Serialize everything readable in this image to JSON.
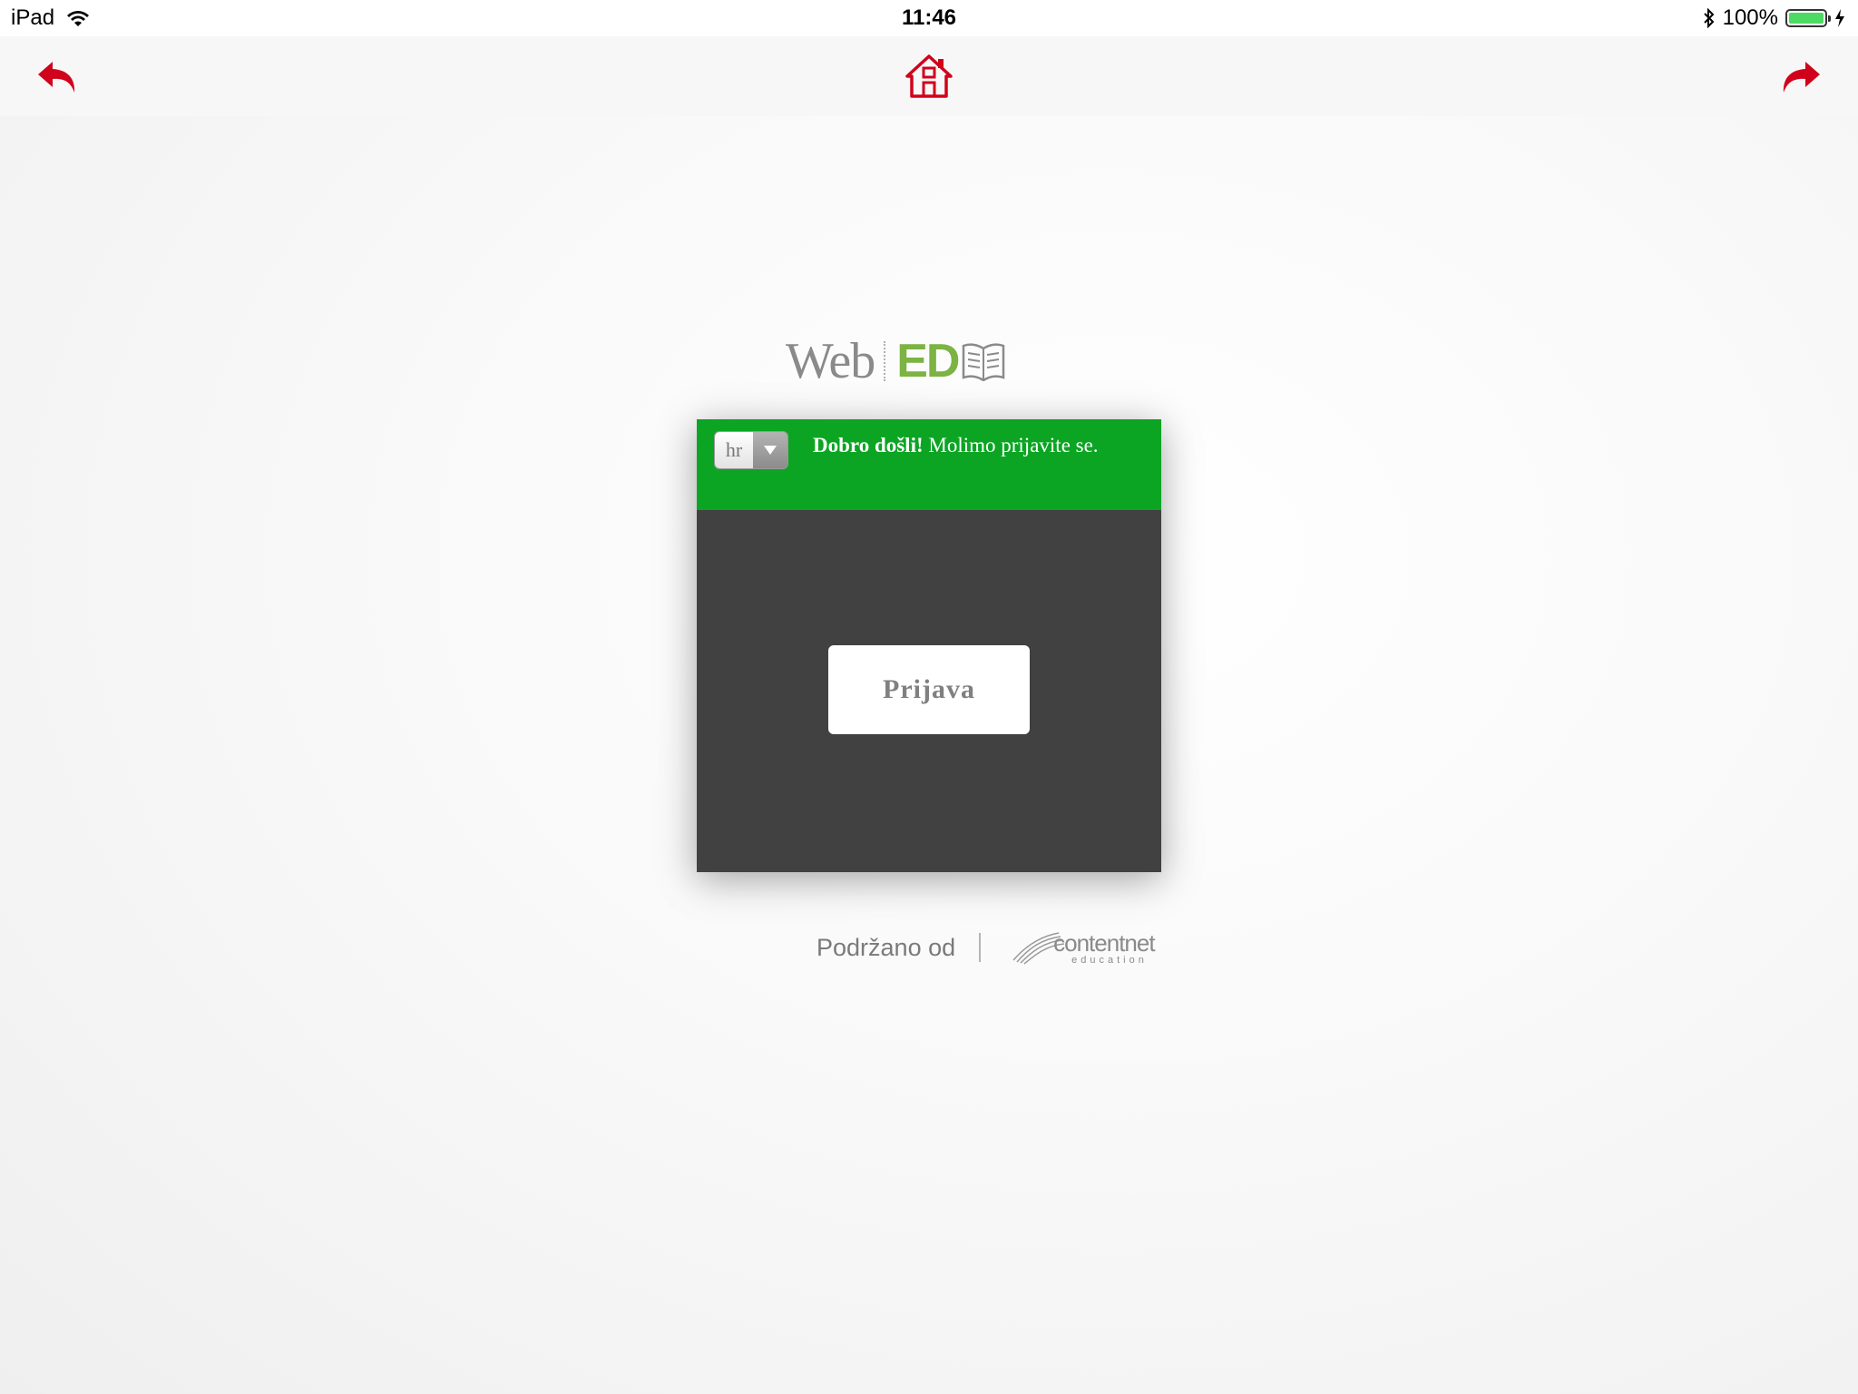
{
  "status_bar": {
    "device": "iPad",
    "time": "11:46",
    "battery": "100%",
    "battery_color": "#4cd964"
  },
  "nav_bar": {
    "back_icon": "undo-arrow-icon",
    "home_icon": "home-icon",
    "forward_icon": "redo-arrow-icon",
    "icon_color": "#d0021b"
  },
  "logo": {
    "web": "Web",
    "ed": "ED"
  },
  "login_panel": {
    "language": "hr",
    "welcome_bold": "Dobro došli!",
    "welcome_text": " Molimo prijavite se.",
    "login_button": "Prijava",
    "header_color": "#0ba523",
    "body_color": "#414141"
  },
  "footer": {
    "powered_by": "Podržano od",
    "partner_name": "contentnet",
    "partner_sub": "education"
  }
}
